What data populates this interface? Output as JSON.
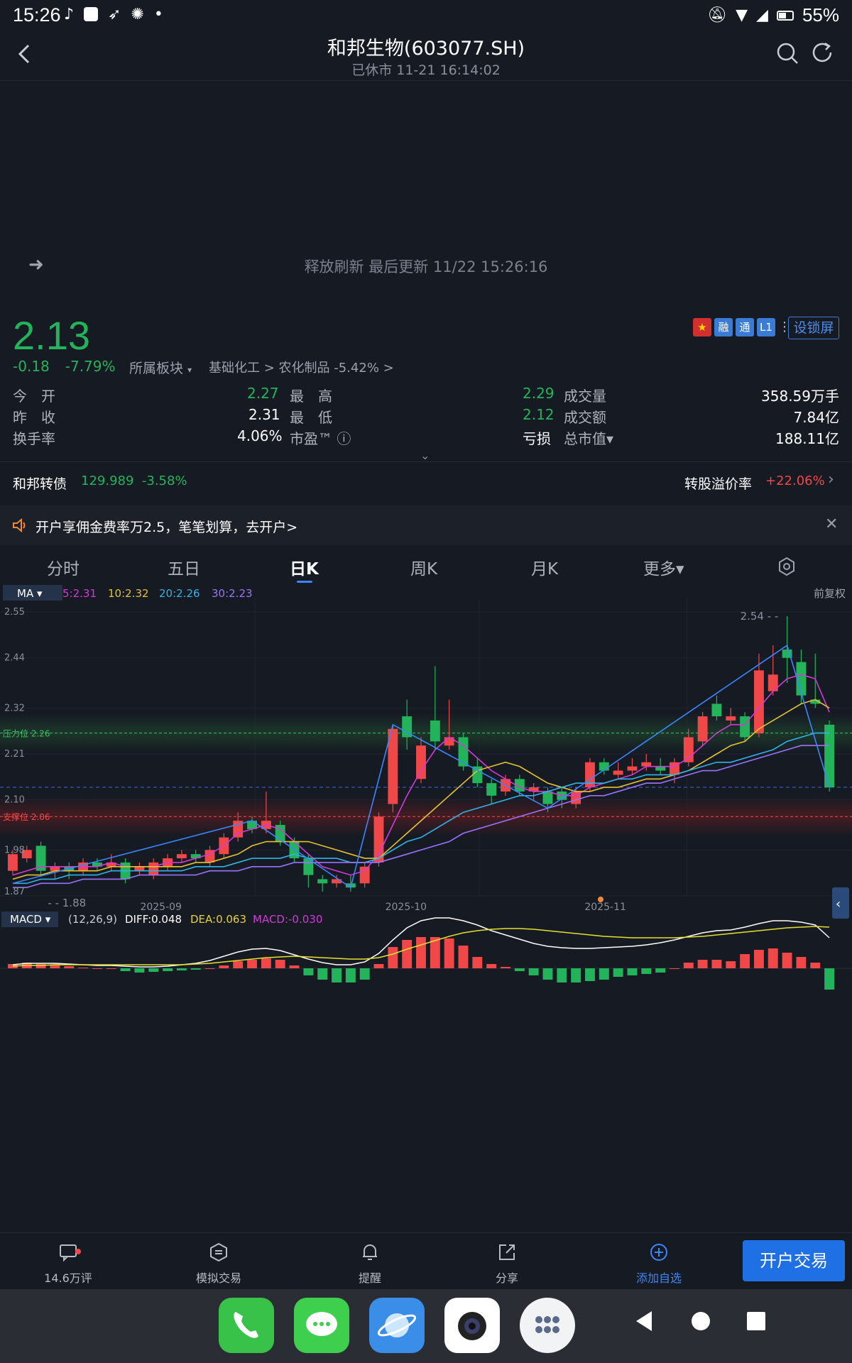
{
  "status_bar": {
    "time": "15:26",
    "battery": "55%"
  },
  "header": {
    "title": "和邦生物(603077.SH)",
    "subtitle": "已休市 11-21 16:14:02"
  },
  "refresh_text": "释放刷新 最后更新 11/22 15:26:16",
  "quote": {
    "price": "2.13",
    "change": "-0.18",
    "change_pct": "-7.79%",
    "sector_label": "所属板块",
    "sector_path": "基础化工 > 农化制品 -5.42% >",
    "badges": [
      "融",
      "通",
      "L1"
    ],
    "lock_btn": "设锁屏",
    "rows": [
      {
        "l1": "今　开",
        "v1": "2.27",
        "l2": "最　高",
        "v2": "2.29",
        "l3": "成交量",
        "v3": "358.59万手"
      },
      {
        "l1": "昨　收",
        "v1": "2.31",
        "l2": "最　低",
        "v2": "2.12",
        "l3": "成交额",
        "v3": "7.84亿"
      },
      {
        "l1": "换手率",
        "v1": "4.06%",
        "l2": "市盈™ ⓘ",
        "v2": "亏损",
        "l3": "总市值▾",
        "v3": "188.11亿"
      }
    ]
  },
  "convertible": {
    "name": "和邦转债",
    "price": "129.989",
    "pct": "-3.58%",
    "premium_label": "转股溢价率",
    "premium_value": "+22.06%"
  },
  "promo": {
    "text": "开户享佣金费率万2.5，笔笔划算，去开户>"
  },
  "tabs": [
    "分时",
    "五日",
    "日K",
    "周K",
    "月K",
    "更多▾"
  ],
  "ma_legend": {
    "label": "MA ▾",
    "ma5": "5:2.31",
    "ma10": "10:2.32",
    "ma20": "20:2.26",
    "ma30": "30:2.23",
    "adjust": "前复权"
  },
  "chart_data": {
    "type": "candlestick",
    "y_ticks": [
      "2.55",
      "2.44",
      "2.32",
      "2.21",
      "2.10",
      "1.98",
      "1.87"
    ],
    "x_ticks": [
      "2025-09",
      "2025-10",
      "2025-11"
    ],
    "ylim": [
      1.87,
      2.55
    ],
    "max_label": "2.54",
    "min_label": "1.88",
    "resistance_label": "压力位 2.26",
    "support_label": "支撑位 2.06",
    "candles": [
      {
        "o": 1.93,
        "c": 1.97,
        "h": 1.98,
        "l": 1.92
      },
      {
        "o": 1.96,
        "c": 1.98,
        "h": 1.99,
        "l": 1.95
      },
      {
        "o": 1.99,
        "c": 1.93,
        "h": 2.0,
        "l": 1.92
      },
      {
        "o": 1.93,
        "c": 1.94,
        "h": 1.95,
        "l": 1.91
      },
      {
        "o": 1.94,
        "c": 1.93,
        "h": 1.95,
        "l": 1.91
      },
      {
        "o": 1.93,
        "c": 1.95,
        "h": 1.96,
        "l": 1.92
      },
      {
        "o": 1.95,
        "c": 1.94,
        "h": 1.96,
        "l": 1.93
      },
      {
        "o": 1.94,
        "c": 1.95,
        "h": 1.97,
        "l": 1.93
      },
      {
        "o": 1.95,
        "c": 1.91,
        "h": 1.96,
        "l": 1.9
      },
      {
        "o": 1.93,
        "c": 1.94,
        "h": 1.95,
        "l": 1.92
      },
      {
        "o": 1.92,
        "c": 1.95,
        "h": 1.96,
        "l": 1.91
      },
      {
        "o": 1.94,
        "c": 1.96,
        "h": 1.97,
        "l": 1.93
      },
      {
        "o": 1.96,
        "c": 1.97,
        "h": 1.98,
        "l": 1.95
      },
      {
        "o": 1.97,
        "c": 1.96,
        "h": 1.98,
        "l": 1.95
      },
      {
        "o": 1.95,
        "c": 1.98,
        "h": 1.99,
        "l": 1.94
      },
      {
        "o": 1.97,
        "c": 2.01,
        "h": 2.02,
        "l": 1.96
      },
      {
        "o": 2.01,
        "c": 2.05,
        "h": 2.07,
        "l": 2.0
      },
      {
        "o": 2.05,
        "c": 2.03,
        "h": 2.06,
        "l": 2.02
      },
      {
        "o": 2.03,
        "c": 2.05,
        "h": 2.12,
        "l": 2.02
      },
      {
        "o": 2.04,
        "c": 2.0,
        "h": 2.05,
        "l": 1.99
      },
      {
        "o": 2.0,
        "c": 1.96,
        "h": 2.01,
        "l": 1.95
      },
      {
        "o": 1.96,
        "c": 1.92,
        "h": 1.97,
        "l": 1.89
      },
      {
        "o": 1.91,
        "c": 1.9,
        "h": 1.92,
        "l": 1.88
      },
      {
        "o": 1.9,
        "c": 1.91,
        "h": 1.92,
        "l": 1.89
      },
      {
        "o": 1.9,
        "c": 1.89,
        "h": 1.92,
        "l": 1.88
      },
      {
        "o": 1.9,
        "c": 1.94,
        "h": 1.95,
        "l": 1.89
      },
      {
        "o": 1.95,
        "c": 2.06,
        "h": 2.07,
        "l": 1.94
      },
      {
        "o": 2.09,
        "c": 2.27,
        "h": 2.28,
        "l": 2.07
      },
      {
        "o": 2.3,
        "c": 2.25,
        "h": 2.34,
        "l": 2.22
      },
      {
        "o": 2.15,
        "c": 2.23,
        "h": 2.25,
        "l": 2.14
      },
      {
        "o": 2.29,
        "c": 2.24,
        "h": 2.42,
        "l": 2.22
      },
      {
        "o": 2.23,
        "c": 2.25,
        "h": 2.34,
        "l": 2.22
      },
      {
        "o": 2.25,
        "c": 2.18,
        "h": 2.26,
        "l": 2.17
      },
      {
        "o": 2.18,
        "c": 2.14,
        "h": 2.2,
        "l": 2.13
      },
      {
        "o": 2.14,
        "c": 2.11,
        "h": 2.15,
        "l": 2.09
      },
      {
        "o": 2.12,
        "c": 2.15,
        "h": 2.16,
        "l": 2.11
      },
      {
        "o": 2.15,
        "c": 2.12,
        "h": 2.16,
        "l": 2.11
      },
      {
        "o": 2.12,
        "c": 2.13,
        "h": 2.14,
        "l": 2.1
      },
      {
        "o": 2.12,
        "c": 2.09,
        "h": 2.13,
        "l": 2.07
      },
      {
        "o": 2.12,
        "c": 2.1,
        "h": 2.13,
        "l": 2.08
      },
      {
        "o": 2.09,
        "c": 2.12,
        "h": 2.13,
        "l": 2.08
      },
      {
        "o": 2.13,
        "c": 2.19,
        "h": 2.2,
        "l": 2.12
      },
      {
        "o": 2.19,
        "c": 2.17,
        "h": 2.2,
        "l": 2.16
      },
      {
        "o": 2.16,
        "c": 2.17,
        "h": 2.19,
        "l": 2.15
      },
      {
        "o": 2.17,
        "c": 2.18,
        "h": 2.2,
        "l": 2.16
      },
      {
        "o": 2.18,
        "c": 2.19,
        "h": 2.21,
        "l": 2.17
      },
      {
        "o": 2.18,
        "c": 2.17,
        "h": 2.2,
        "l": 2.16
      },
      {
        "o": 2.16,
        "c": 2.19,
        "h": 2.2,
        "l": 2.14
      },
      {
        "o": 2.19,
        "c": 2.25,
        "h": 2.27,
        "l": 2.18
      },
      {
        "o": 2.24,
        "c": 2.3,
        "h": 2.31,
        "l": 2.23
      },
      {
        "o": 2.33,
        "c": 2.3,
        "h": 2.35,
        "l": 2.29
      },
      {
        "o": 2.29,
        "c": 2.3,
        "h": 2.32,
        "l": 2.28
      },
      {
        "o": 2.3,
        "c": 2.25,
        "h": 2.31,
        "l": 2.24
      },
      {
        "o": 2.26,
        "c": 2.41,
        "h": 2.45,
        "l": 2.25
      },
      {
        "o": 2.36,
        "c": 2.4,
        "h": 2.47,
        "l": 2.35
      },
      {
        "o": 2.46,
        "c": 2.44,
        "h": 2.54,
        "l": 2.38
      },
      {
        "o": 2.43,
        "c": 2.35,
        "h": 2.46,
        "l": 2.33
      },
      {
        "o": 2.34,
        "c": 2.33,
        "h": 2.45,
        "l": 2.32
      },
      {
        "o": 2.28,
        "c": 2.13,
        "h": 2.29,
        "l": 2.12
      }
    ],
    "ma_lines": {
      "ma5": [
        1.92,
        1.93,
        1.94,
        1.94,
        1.94,
        1.94,
        1.94,
        1.95,
        1.94,
        1.94,
        1.94,
        1.95,
        1.95,
        1.96,
        1.97,
        1.99,
        2.02,
        2.03,
        2.04,
        2.03,
        2.0,
        1.97,
        1.94,
        1.93,
        1.92,
        1.93,
        1.97,
        2.04,
        2.11,
        2.17,
        2.22,
        2.25,
        2.23,
        2.2,
        2.17,
        2.15,
        2.13,
        2.12,
        2.12,
        2.11,
        2.11,
        2.13,
        2.14,
        2.15,
        2.16,
        2.18,
        2.18,
        2.18,
        2.2,
        2.23,
        2.26,
        2.28,
        2.28,
        2.32,
        2.36,
        2.39,
        2.4,
        2.39,
        2.31
      ],
      "ma10": [
        1.91,
        1.92,
        1.92,
        1.93,
        1.93,
        1.93,
        1.93,
        1.94,
        1.94,
        1.94,
        1.94,
        1.94,
        1.94,
        1.95,
        1.95,
        1.96,
        1.97,
        1.99,
        2.0,
        2.0,
        2.0,
        2.0,
        1.99,
        1.98,
        1.97,
        1.96,
        1.96,
        1.99,
        2.02,
        2.05,
        2.08,
        2.11,
        2.14,
        2.17,
        2.18,
        2.19,
        2.18,
        2.16,
        2.14,
        2.13,
        2.12,
        2.12,
        2.13,
        2.13,
        2.14,
        2.15,
        2.15,
        2.16,
        2.17,
        2.19,
        2.21,
        2.23,
        2.24,
        2.27,
        2.29,
        2.31,
        2.33,
        2.34,
        2.32
      ],
      "ma20": [
        1.9,
        1.9,
        1.91,
        1.91,
        1.92,
        1.92,
        1.92,
        1.93,
        1.93,
        1.93,
        1.93,
        1.93,
        1.93,
        1.94,
        1.94,
        1.94,
        1.95,
        1.96,
        1.96,
        1.96,
        1.97,
        1.96,
        1.96,
        1.96,
        1.95,
        1.95,
        1.96,
        1.98,
        2.0,
        2.01,
        2.03,
        2.05,
        2.07,
        2.08,
        2.09,
        2.1,
        2.11,
        2.11,
        2.12,
        2.13,
        2.14,
        2.14,
        2.14,
        2.15,
        2.15,
        2.16,
        2.16,
        2.16,
        2.17,
        2.18,
        2.19,
        2.19,
        2.2,
        2.21,
        2.22,
        2.24,
        2.25,
        2.26,
        2.26
      ],
      "ma30": [
        1.89,
        1.89,
        1.9,
        1.9,
        1.9,
        1.91,
        1.91,
        1.91,
        1.91,
        1.92,
        1.92,
        1.92,
        1.92,
        1.92,
        1.93,
        1.93,
        1.93,
        1.94,
        1.94,
        1.94,
        1.95,
        1.95,
        1.95,
        1.95,
        1.95,
        1.95,
        1.95,
        1.96,
        1.97,
        1.98,
        1.99,
        2.0,
        2.02,
        2.03,
        2.04,
        2.05,
        2.06,
        2.07,
        2.08,
        2.09,
        2.1,
        2.11,
        2.11,
        2.12,
        2.13,
        2.14,
        2.14,
        2.15,
        2.16,
        2.17,
        2.17,
        2.18,
        2.19,
        2.2,
        2.21,
        2.22,
        2.23,
        2.23,
        2.23
      ]
    },
    "macd": {
      "label": "MACD ▾",
      "params": "(12,26,9)",
      "diff": "DIFF:0.048",
      "dea": "DEA:0.063",
      "macd": "MACD:-0.030",
      "hist": [
        0.006,
        0.008,
        0.006,
        0.005,
        0.003,
        0.001,
        0,
        0,
        -0.004,
        -0.006,
        -0.005,
        -0.004,
        -0.003,
        -0.002,
        0,
        0.004,
        0.01,
        0.012,
        0.014,
        0.012,
        0.004,
        -0.01,
        -0.016,
        -0.02,
        -0.02,
        -0.016,
        0.006,
        0.03,
        0.04,
        0.044,
        0.044,
        0.042,
        0.032,
        0.016,
        0.006,
        0.002,
        -0.004,
        -0.01,
        -0.016,
        -0.02,
        -0.02,
        -0.018,
        -0.016,
        -0.012,
        -0.01,
        -0.008,
        -0.006,
        0,
        0.008,
        0.012,
        0.012,
        0.01,
        0.02,
        0.026,
        0.028,
        0.022,
        0.016,
        0.008,
        -0.03
      ],
      "diff_line": [
        0.01,
        0.012,
        0.012,
        0.012,
        0.011,
        0.01,
        0.009,
        0.009,
        0.008,
        0.007,
        0.007,
        0.008,
        0.01,
        0.012,
        0.016,
        0.022,
        0.028,
        0.032,
        0.033,
        0.03,
        0.024,
        0.018,
        0.013,
        0.01,
        0.01,
        0.014,
        0.026,
        0.045,
        0.062,
        0.072,
        0.076,
        0.076,
        0.072,
        0.066,
        0.058,
        0.052,
        0.046,
        0.04,
        0.036,
        0.034,
        0.033,
        0.033,
        0.034,
        0.035,
        0.036,
        0.038,
        0.041,
        0.045,
        0.05,
        0.055,
        0.058,
        0.059,
        0.063,
        0.068,
        0.072,
        0.072,
        0.07,
        0.066,
        0.048
      ],
      "dea_line": [
        0.008,
        0.009,
        0.009,
        0.01,
        0.01,
        0.01,
        0.01,
        0.01,
        0.01,
        0.01,
        0.01,
        0.01,
        0.01,
        0.011,
        0.012,
        0.014,
        0.016,
        0.018,
        0.02,
        0.021,
        0.022,
        0.021,
        0.02,
        0.019,
        0.018,
        0.018,
        0.02,
        0.025,
        0.032,
        0.038,
        0.044,
        0.05,
        0.055,
        0.058,
        0.06,
        0.061,
        0.061,
        0.06,
        0.058,
        0.056,
        0.054,
        0.052,
        0.05,
        0.049,
        0.048,
        0.048,
        0.048,
        0.048,
        0.049,
        0.05,
        0.052,
        0.054,
        0.056,
        0.058,
        0.06,
        0.062,
        0.063,
        0.064,
        0.063
      ]
    }
  },
  "bottom_nav": [
    {
      "label": "14.6万评",
      "icon": "comment-icon"
    },
    {
      "label": "模拟交易",
      "icon": "sim-trade-icon"
    },
    {
      "label": "提醒",
      "icon": "bell-icon"
    },
    {
      "label": "分享",
      "icon": "share-icon"
    },
    {
      "label": "添加自选",
      "icon": "add-circle-icon"
    }
  ],
  "trade_button": "开户交易"
}
